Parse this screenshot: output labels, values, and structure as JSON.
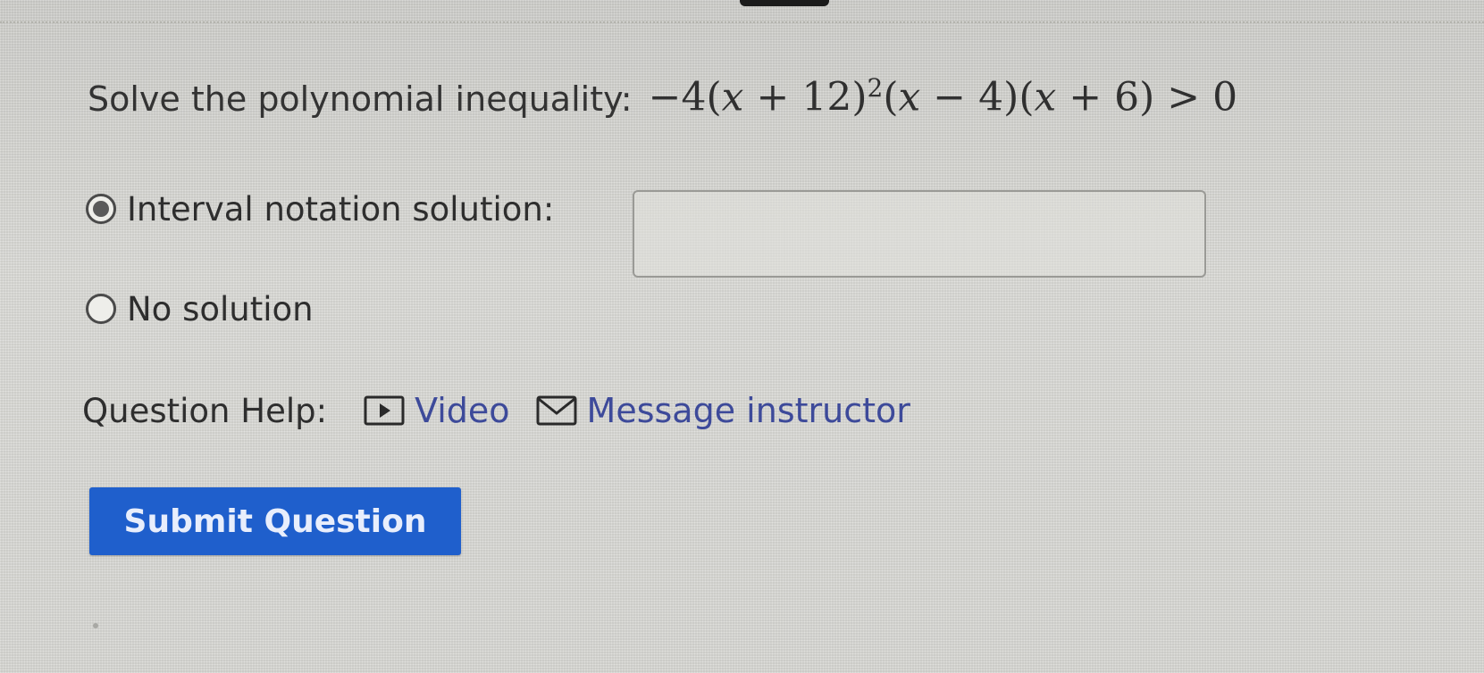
{
  "question": {
    "prompt": "Solve the polynomial inequality:",
    "math_before": "−4(",
    "math_var1": "x",
    "math_mid1": " + 12)",
    "math_exp": "2",
    "math_mid2": "(",
    "math_var2": "x",
    "math_mid3": " − 4)(",
    "math_var3": "x",
    "math_end": " + 6) > 0"
  },
  "options": [
    {
      "label": "Interval notation solution:",
      "selected": true
    },
    {
      "label": "No solution",
      "selected": false
    }
  ],
  "answer_input": {
    "value": "",
    "placeholder": ""
  },
  "help": {
    "label": "Question Help:",
    "video_label": "Video",
    "video_icon": "video-icon",
    "message_label": "Message instructor",
    "message_icon": "envelope-icon"
  },
  "submit_label": "Submit Question",
  "colors": {
    "link": "#3d4a9a",
    "button": "#1f5fcc"
  }
}
